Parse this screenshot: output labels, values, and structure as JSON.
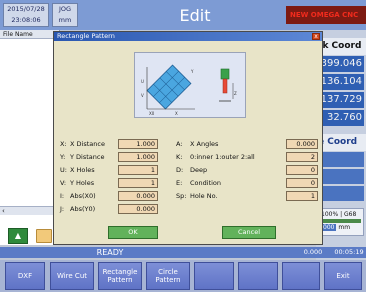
{
  "topbar": {
    "date": "2015/07/28",
    "time": "23:08:06",
    "unit_top": "JOG",
    "unit_bottom": "mm",
    "title": "Edit",
    "machine": "NEW OMEGA CNC"
  },
  "file_panel": {
    "header": "File Name"
  },
  "right_panel": {
    "work_coord_label": "rk Coord",
    "work_coords": [
      "399.046",
      "136.104",
      "137.729",
      "32.760"
    ],
    "machine_coord_label": "e Coord",
    "feed_text": "100%",
    "feed_value": "G68",
    "feed_units": "000",
    "feed_unit_label": "mm"
  },
  "status": {
    "ready": "READY",
    "value1": "0.000",
    "value2": "00:05:19"
  },
  "toolbar": {
    "buttons": [
      "DXF",
      "Wire Cut",
      "Rectangle Pattern",
      "Circle Pattern",
      "",
      "",
      "",
      "Exit"
    ]
  },
  "dialog": {
    "title": "Rectangle Pattern",
    "close_label": "x",
    "left_fields": [
      {
        "key": "X:",
        "label": "X Distance",
        "value": "1.000"
      },
      {
        "key": "Y:",
        "label": "Y Distance",
        "value": "1.000"
      },
      {
        "key": "U:",
        "label": "X Holes",
        "value": "1"
      },
      {
        "key": "V:",
        "label": "Y Holes",
        "value": "1"
      },
      {
        "key": "I:",
        "label": "Abs(X0)",
        "value": "0.000"
      },
      {
        "key": "J:",
        "label": "Abs(Y0)",
        "value": "0.000"
      }
    ],
    "right_fields": [
      {
        "key": "A:",
        "label": "X Angles",
        "value": "0.000"
      },
      {
        "key": "K:",
        "label": "0:inner 1:outer 2:all",
        "value": "2"
      },
      {
        "key": "D:",
        "label": "Deep",
        "value": "0"
      },
      {
        "key": "E:",
        "label": "Condition",
        "value": "0"
      },
      {
        "key": "Sp:",
        "label": "Hole No.",
        "value": "1"
      }
    ],
    "ok_label": "OK",
    "cancel_label": "Cancel",
    "diagram_labels": {
      "u_label": "U",
      "v_label": "V",
      "x_label": "X",
      "y_label": "Y",
      "origin_label": "X0",
      "z_label": "Z"
    }
  },
  "colors": {
    "topbar": "#7d9bd4",
    "coord_blue": "#2f5fb3",
    "machine_red": "#f12b1d",
    "dialog_bg": "#e8e4c8",
    "input_bg": "#f0d8b4",
    "button_green": "#62b25b"
  }
}
